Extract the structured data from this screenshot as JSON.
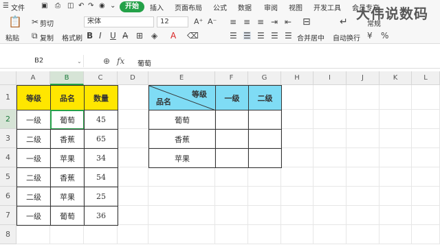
{
  "menu": {
    "file": "文件",
    "tabs": [
      "开始",
      "插入",
      "页面布局",
      "公式",
      "数据",
      "审阅",
      "视图",
      "开发工具",
      "会员专享"
    ]
  },
  "ribbon": {
    "paste": "粘贴",
    "cut": "剪切",
    "copy": "复制",
    "format_painter": "格式刷",
    "font_name": "宋体",
    "font_size": "12",
    "merge_center": "合并居中",
    "wrap_text": "自动换行",
    "number_format": "常规"
  },
  "formula_bar": {
    "name_box": "B2",
    "fx": "fx",
    "content": "葡萄"
  },
  "columns": [
    "A",
    "B",
    "C",
    "D",
    "E",
    "F",
    "G",
    "H",
    "I",
    "J",
    "K",
    "L"
  ],
  "rows": [
    "1",
    "2",
    "3",
    "4",
    "5",
    "6",
    "7",
    "8"
  ],
  "table1": {
    "headers": [
      "等级",
      "品名",
      "数量"
    ],
    "rows": [
      [
        "一级",
        "葡萄",
        "45"
      ],
      [
        "二级",
        "香蕉",
        "65"
      ],
      [
        "一级",
        "苹果",
        "34"
      ],
      [
        "二级",
        "香蕉",
        "54"
      ],
      [
        "二级",
        "苹果",
        "25"
      ],
      [
        "一级",
        "葡萄",
        "36"
      ]
    ]
  },
  "table2": {
    "diag_top": "等级",
    "diag_bottom": "品名",
    "headers": [
      "一级",
      "二级"
    ],
    "rows": [
      "葡萄",
      "香蕉",
      "苹果"
    ]
  },
  "watermark": "大伟说数码",
  "colors": {
    "accent_green": "#24a148",
    "yellow_header": "#ffe600",
    "cyan_header": "#7fdcf5"
  }
}
